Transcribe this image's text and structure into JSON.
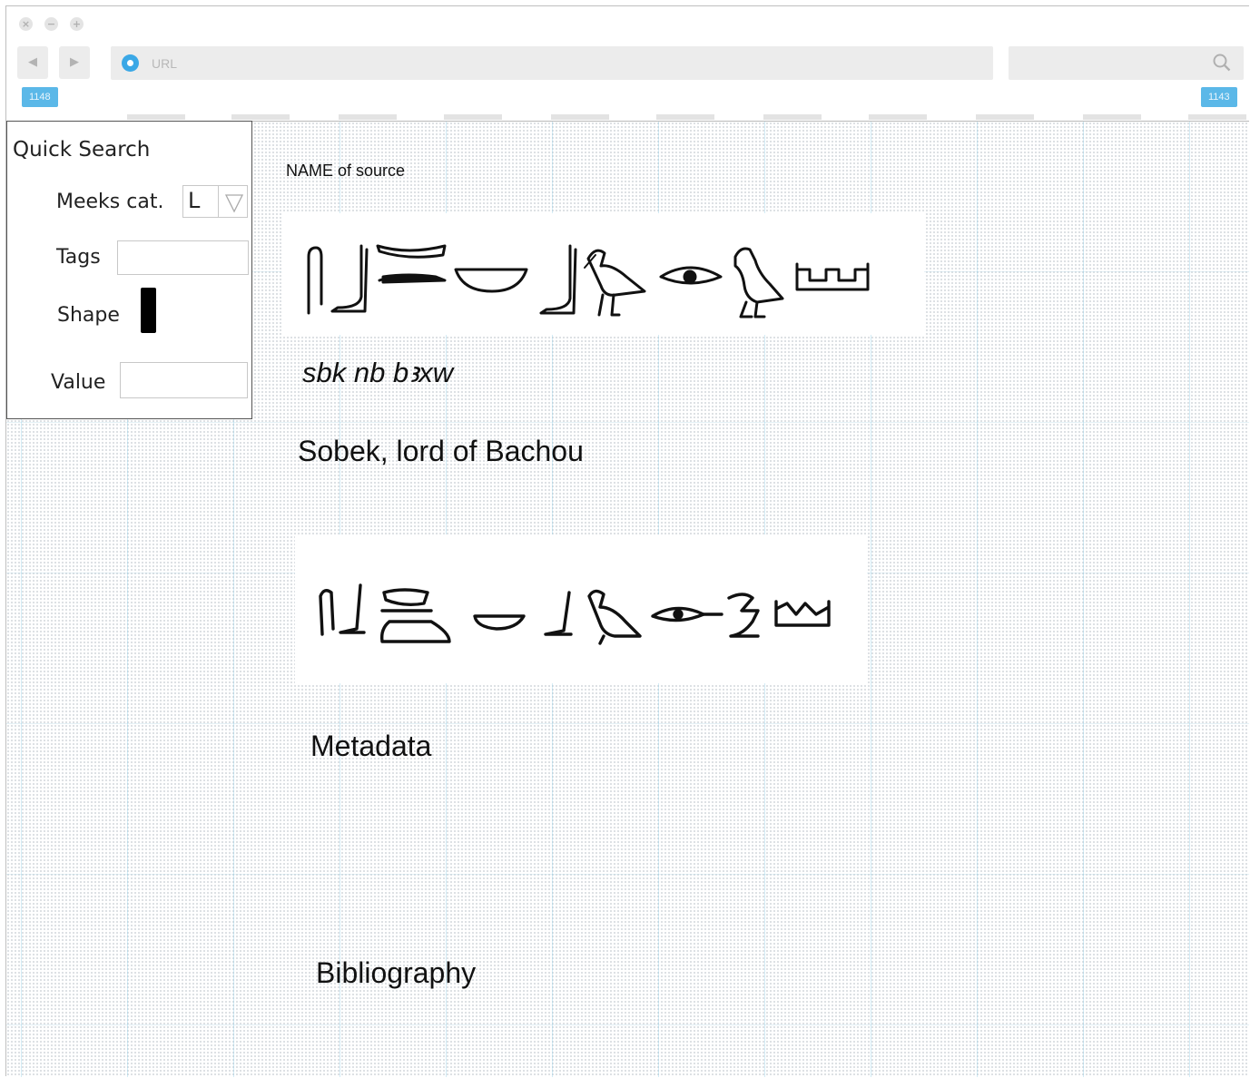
{
  "browser": {
    "window_buttons": [
      "×",
      "−",
      "+"
    ],
    "nav_back": "◀",
    "nav_forward": "▶",
    "url_placeholder": "URL",
    "page_tag_left": "1148",
    "page_tag_right": "1143",
    "accent_color": "#3ba8e6"
  },
  "quick_search": {
    "title": "Quick Search",
    "meeks_label": "Meeks cat.",
    "meeks_value": "L",
    "tags_label": "Tags",
    "tags_value": "",
    "shape_label": "Shape",
    "shape_color": "#000000",
    "value_label": "Value",
    "value_value": ""
  },
  "entry": {
    "source_label": "NAME of source",
    "transliteration": "sbk nb bꜣxw",
    "translation": "Sobek, lord of Bachou",
    "sections": {
      "metadata": "Metadata",
      "bibliography": "Bibliography"
    }
  }
}
